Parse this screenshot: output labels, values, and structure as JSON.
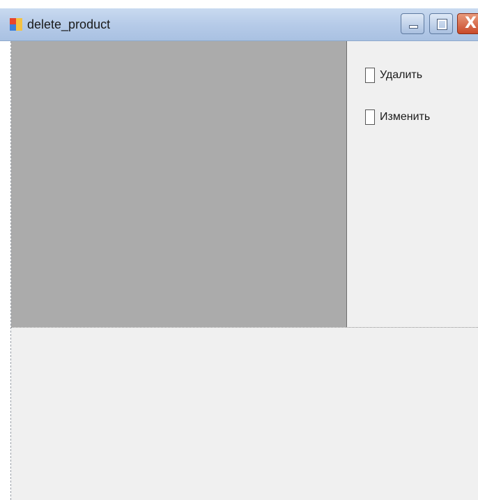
{
  "window": {
    "title": "delete_product",
    "icon": "windows-forms-app-icon",
    "buttons": [
      "minimize-button",
      "maximize-button",
      "close-button"
    ],
    "close_glyph": "X"
  },
  "options": [
    {
      "label": "Удалить",
      "checked": false
    },
    {
      "label": "Изменить",
      "checked": false
    }
  ],
  "colors": {
    "titlebar": "#b6cbe8",
    "grid_background": "#ababab",
    "form_background": "#f0f0f0",
    "close_button": "#c94a2a"
  }
}
